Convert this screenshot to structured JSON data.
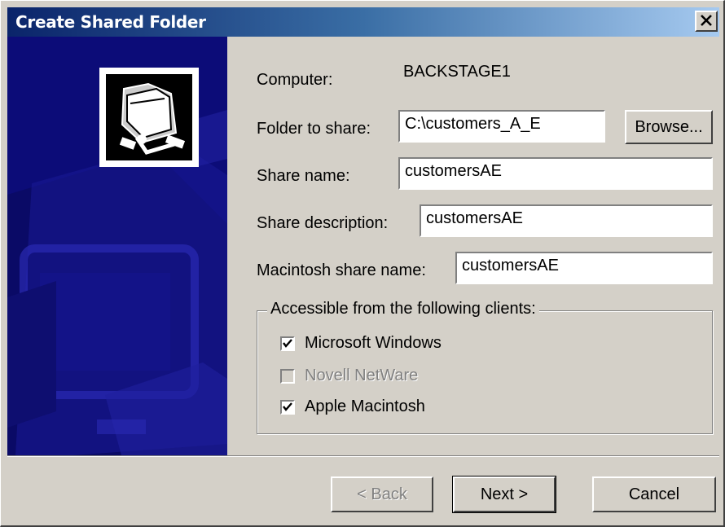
{
  "window": {
    "title": "Create Shared Folder",
    "close_glyph": "✕"
  },
  "form": {
    "computer_label": "Computer:",
    "computer_value": "BACKSTAGE1",
    "folder_label": "Folder to share:",
    "folder_value": "C:\\customers_A_E",
    "browse_label": "Browse...",
    "share_name_label": "Share name:",
    "share_name_value": "customersAE",
    "share_desc_label": "Share description:",
    "share_desc_value": "customersAE",
    "mac_share_label": "Macintosh share name:",
    "mac_share_value": "customersAE"
  },
  "clients": {
    "legend": "Accessible from the following clients:",
    "items": [
      {
        "label": "Microsoft Windows",
        "checked": true,
        "enabled": true
      },
      {
        "label": "Novell NetWare",
        "checked": false,
        "enabled": false
      },
      {
        "label": "Apple Macintosh",
        "checked": true,
        "enabled": true
      }
    ]
  },
  "buttons": {
    "back": "< Back",
    "next": "Next >",
    "cancel": "Cancel"
  },
  "icons": {
    "banner_icon": "shared-folder-icon",
    "close": "close-icon",
    "check": "checkmark-icon"
  },
  "colors": {
    "title_start": "#0a246a",
    "title_end": "#a6caf0",
    "banner": "#0c0c78",
    "face": "#d4d0c8"
  }
}
